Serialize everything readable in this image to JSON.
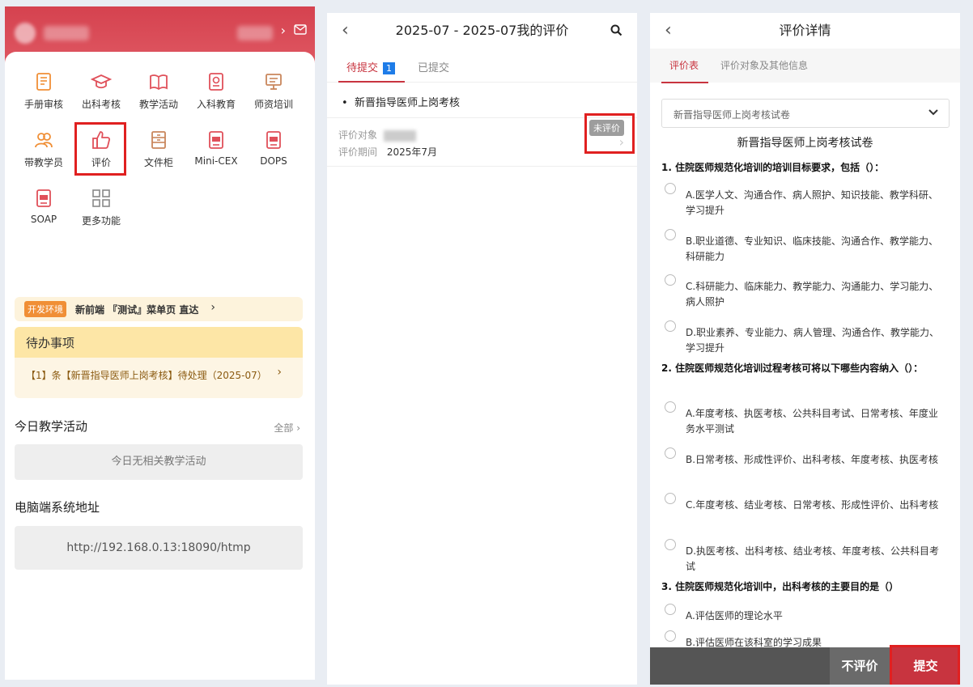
{
  "home": {
    "grid": [
      {
        "label": "手册审核",
        "icon": "handbook-icon"
      },
      {
        "label": "出科考核",
        "icon": "graduation-cap-icon"
      },
      {
        "label": "教学活动",
        "icon": "open-book-icon"
      },
      {
        "label": "入科教育",
        "icon": "document-icon"
      },
      {
        "label": "师资培训",
        "icon": "presentation-icon"
      },
      {
        "label": "带教学员",
        "icon": "users-icon"
      },
      {
        "label": "评价",
        "icon": "thumbs-up-icon"
      },
      {
        "label": "文件柜",
        "icon": "cabinet-icon"
      },
      {
        "label": "Mini-CEX",
        "icon": "cex-icon"
      },
      {
        "label": "DOPS",
        "icon": "dops-icon"
      },
      {
        "label": "SOAP",
        "icon": "soap-icon"
      },
      {
        "label": "更多功能",
        "icon": "grid-more-icon"
      }
    ],
    "dev_tag": "开发环境",
    "dev_text": "新前端 『测试』菜单页 直达",
    "todo_title": "待办事项",
    "todo_item": "【1】条【新晋指导医师上岗考核】待处理（2025-07）",
    "today_title": "今日教学活动",
    "today_more": "全部",
    "today_empty": "今日无相关教学活动",
    "pc_title": "电脑端系统地址",
    "pc_url": "http://192.168.0.13:18090/htmp"
  },
  "evallist": {
    "title": "2025-07 - 2025-07我的评价",
    "tab_pending": "待提交",
    "tab_pending_count": "1",
    "tab_submitted": "已提交",
    "group": "新晋指导医师上岗考核",
    "target_label": "评价对象",
    "period_label": "评价期间",
    "period_value": "2025年7月",
    "status": "未评价"
  },
  "detail": {
    "title": "评价详情",
    "tab_form": "评价表",
    "tab_info": "评价对象及其他信息",
    "select_value": "新晋指导医师上岗考核试卷",
    "paper_title": "新晋指导医师上岗考核试卷",
    "questions": [
      {
        "q": "1. 住院医师规范化培训的培训目标要求，包括（）：",
        "options": [
          "A.医学人文、沟通合作、病人照护、知识技能、教学科研、学习提升",
          "B.职业道德、专业知识、临床技能、沟通合作、教学能力、科研能力",
          "C.科研能力、临床能力、教学能力、沟通能力、学习能力、病人照护",
          "D.职业素养、专业能力、病人管理、沟通合作、教学能力、学习提升"
        ]
      },
      {
        "q": "2. 住院医师规范化培训过程考核可将以下哪些内容纳入（）：",
        "options": [
          "A.年度考核、执医考核、公共科目考试、日常考核、年度业务水平测试",
          "B.日常考核、形成性评价、出科考核、年度考核、执医考核",
          "C.年度考核、结业考核、日常考核、形成性评价、出科考核",
          "D.执医考核、出科考核、结业考核、年度考核、公共科目考试"
        ]
      },
      {
        "q": "3. 住院医师规范化培训中，出科考核的主要目的是（）",
        "options": [
          "A.评估医师的理论水平",
          "B.评估医师在该科室的学习成果"
        ]
      }
    ],
    "btn_skip": "不评价",
    "btn_submit": "提交"
  }
}
